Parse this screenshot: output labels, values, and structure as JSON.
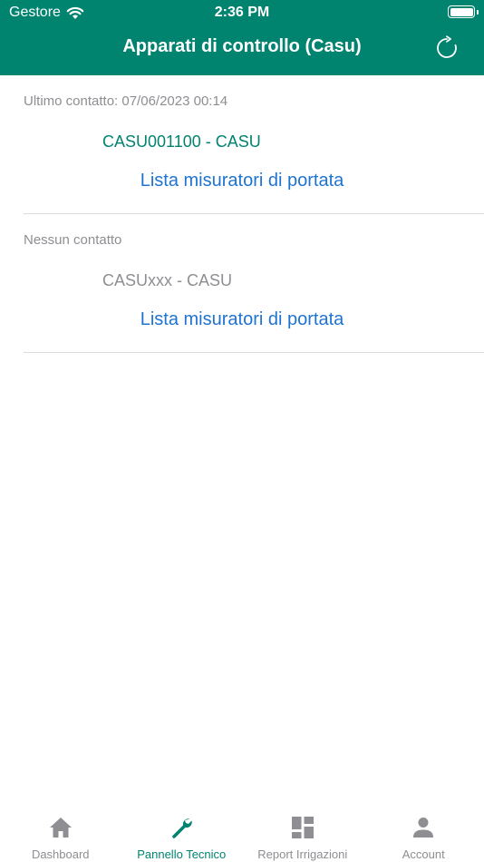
{
  "status_bar": {
    "carrier": "Gestore",
    "time": "2:36 PM"
  },
  "nav": {
    "title": "Apparati di controllo (Casu)",
    "refresh_icon": "refresh-icon"
  },
  "devices": [
    {
      "status": "Ultimo contatto: 07/06/2023 00:14",
      "name": "CASU001100 - CASU",
      "name_color": "#00836f",
      "link": "Lista misuratori di portata"
    },
    {
      "status": "Nessun contatto",
      "name": "CASUxxx - CASU",
      "name_color": "#8e8e93",
      "link": "Lista misuratori di portata"
    }
  ],
  "tab_bar": {
    "tabs": [
      {
        "label": "Dashboard",
        "icon": "home-icon",
        "active": false
      },
      {
        "label": "Pannello Tecnico",
        "icon": "wrench-icon",
        "active": true
      },
      {
        "label": "Report Irrigazioni",
        "icon": "grid-icon",
        "active": false
      },
      {
        "label": "Account",
        "icon": "person-icon",
        "active": false
      }
    ]
  },
  "colors": {
    "brand": "#00836f",
    "link": "#1f73d1",
    "muted": "#8e8e93"
  }
}
